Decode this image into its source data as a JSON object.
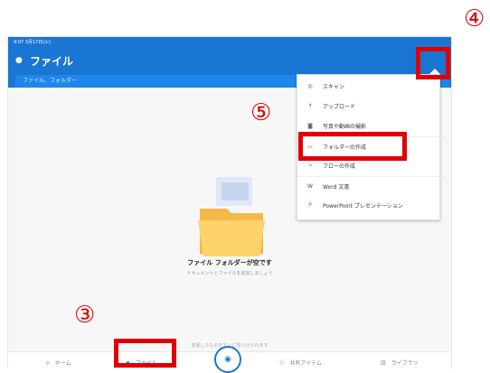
{
  "status": {
    "left": "9:07  3月17日(火)",
    "right": ""
  },
  "header": {
    "title": "ファイル",
    "plus_label": "+"
  },
  "search": {
    "placeholder": "ファイル、フォルダー"
  },
  "menu": {
    "items": [
      {
        "label": "スキャン",
        "icon": "scan-icon"
      },
      {
        "label": "アップロード",
        "icon": "upload-icon"
      },
      {
        "label": "写真や動画の撮影",
        "icon": "camera-icon"
      },
      {
        "label": "フォルダーの作成",
        "icon": "folder-icon"
      },
      {
        "label": "フローの作成",
        "icon": "flow-icon"
      },
      {
        "label": "Word 文書",
        "icon": "word-icon"
      },
      {
        "label": "PowerPoint プレゼンテーション",
        "icon": "powerpoint-icon"
      }
    ]
  },
  "empty": {
    "title": "ファイル フォルダーが空です",
    "subtitle": "ドキュメントとファイルを追加しましょう"
  },
  "bottom_hint": "変更したものをすぐに見つけられます",
  "nav": {
    "home": "ホーム",
    "files": "ファイル",
    "shared": "共有アイテム",
    "library": "ライブラリ"
  },
  "annotations": {
    "n3": "③",
    "n4": "④",
    "n5": "⑤"
  },
  "colors": {
    "accent": "#1976d2",
    "highlight": "#e00000"
  }
}
